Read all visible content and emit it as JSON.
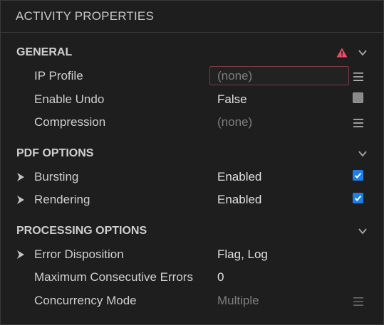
{
  "panel": {
    "title": "ACTIVITY PROPERTIES"
  },
  "sections": [
    {
      "title": "GENERAL",
      "has_warning": true,
      "rows": [
        {
          "label": "IP Profile",
          "value": "(none)",
          "value_style": "input-error",
          "control": "menu-icon"
        },
        {
          "label": "Enable Undo",
          "value": "False",
          "control": "checkbox",
          "checked": false
        },
        {
          "label": "Compression",
          "value": "(none)",
          "value_style": "muted",
          "control": "menu-icon"
        }
      ]
    },
    {
      "title": "PDF OPTIONS",
      "rows": [
        {
          "label": "Bursting",
          "value": "Enabled",
          "expandable": true,
          "control": "checkbox",
          "checked": true
        },
        {
          "label": "Rendering",
          "value": "Enabled",
          "expandable": true,
          "control": "checkbox",
          "checked": true
        }
      ]
    },
    {
      "title": "PROCESSING OPTIONS",
      "rows": [
        {
          "label": "Error Disposition",
          "value": "Flag, Log",
          "expandable": true
        },
        {
          "label": "Maximum Consecutive Errors",
          "value": "0"
        },
        {
          "label": "Concurrency Mode",
          "value": "Multiple",
          "value_style": "muted",
          "control": "menu-icon-dim"
        }
      ]
    }
  ],
  "colors": {
    "background": "#1e1e1e",
    "warning": "#e8506a",
    "checkbox_on": "#1e7fe6",
    "error_border": "#7a3a43"
  },
  "icons": {
    "collapse": "chevron-down-icon",
    "expand": "chevron-right-icon",
    "warning": "warning-triangle-icon",
    "menu": "hamburger-menu-icon",
    "check": "checkmark-icon"
  }
}
